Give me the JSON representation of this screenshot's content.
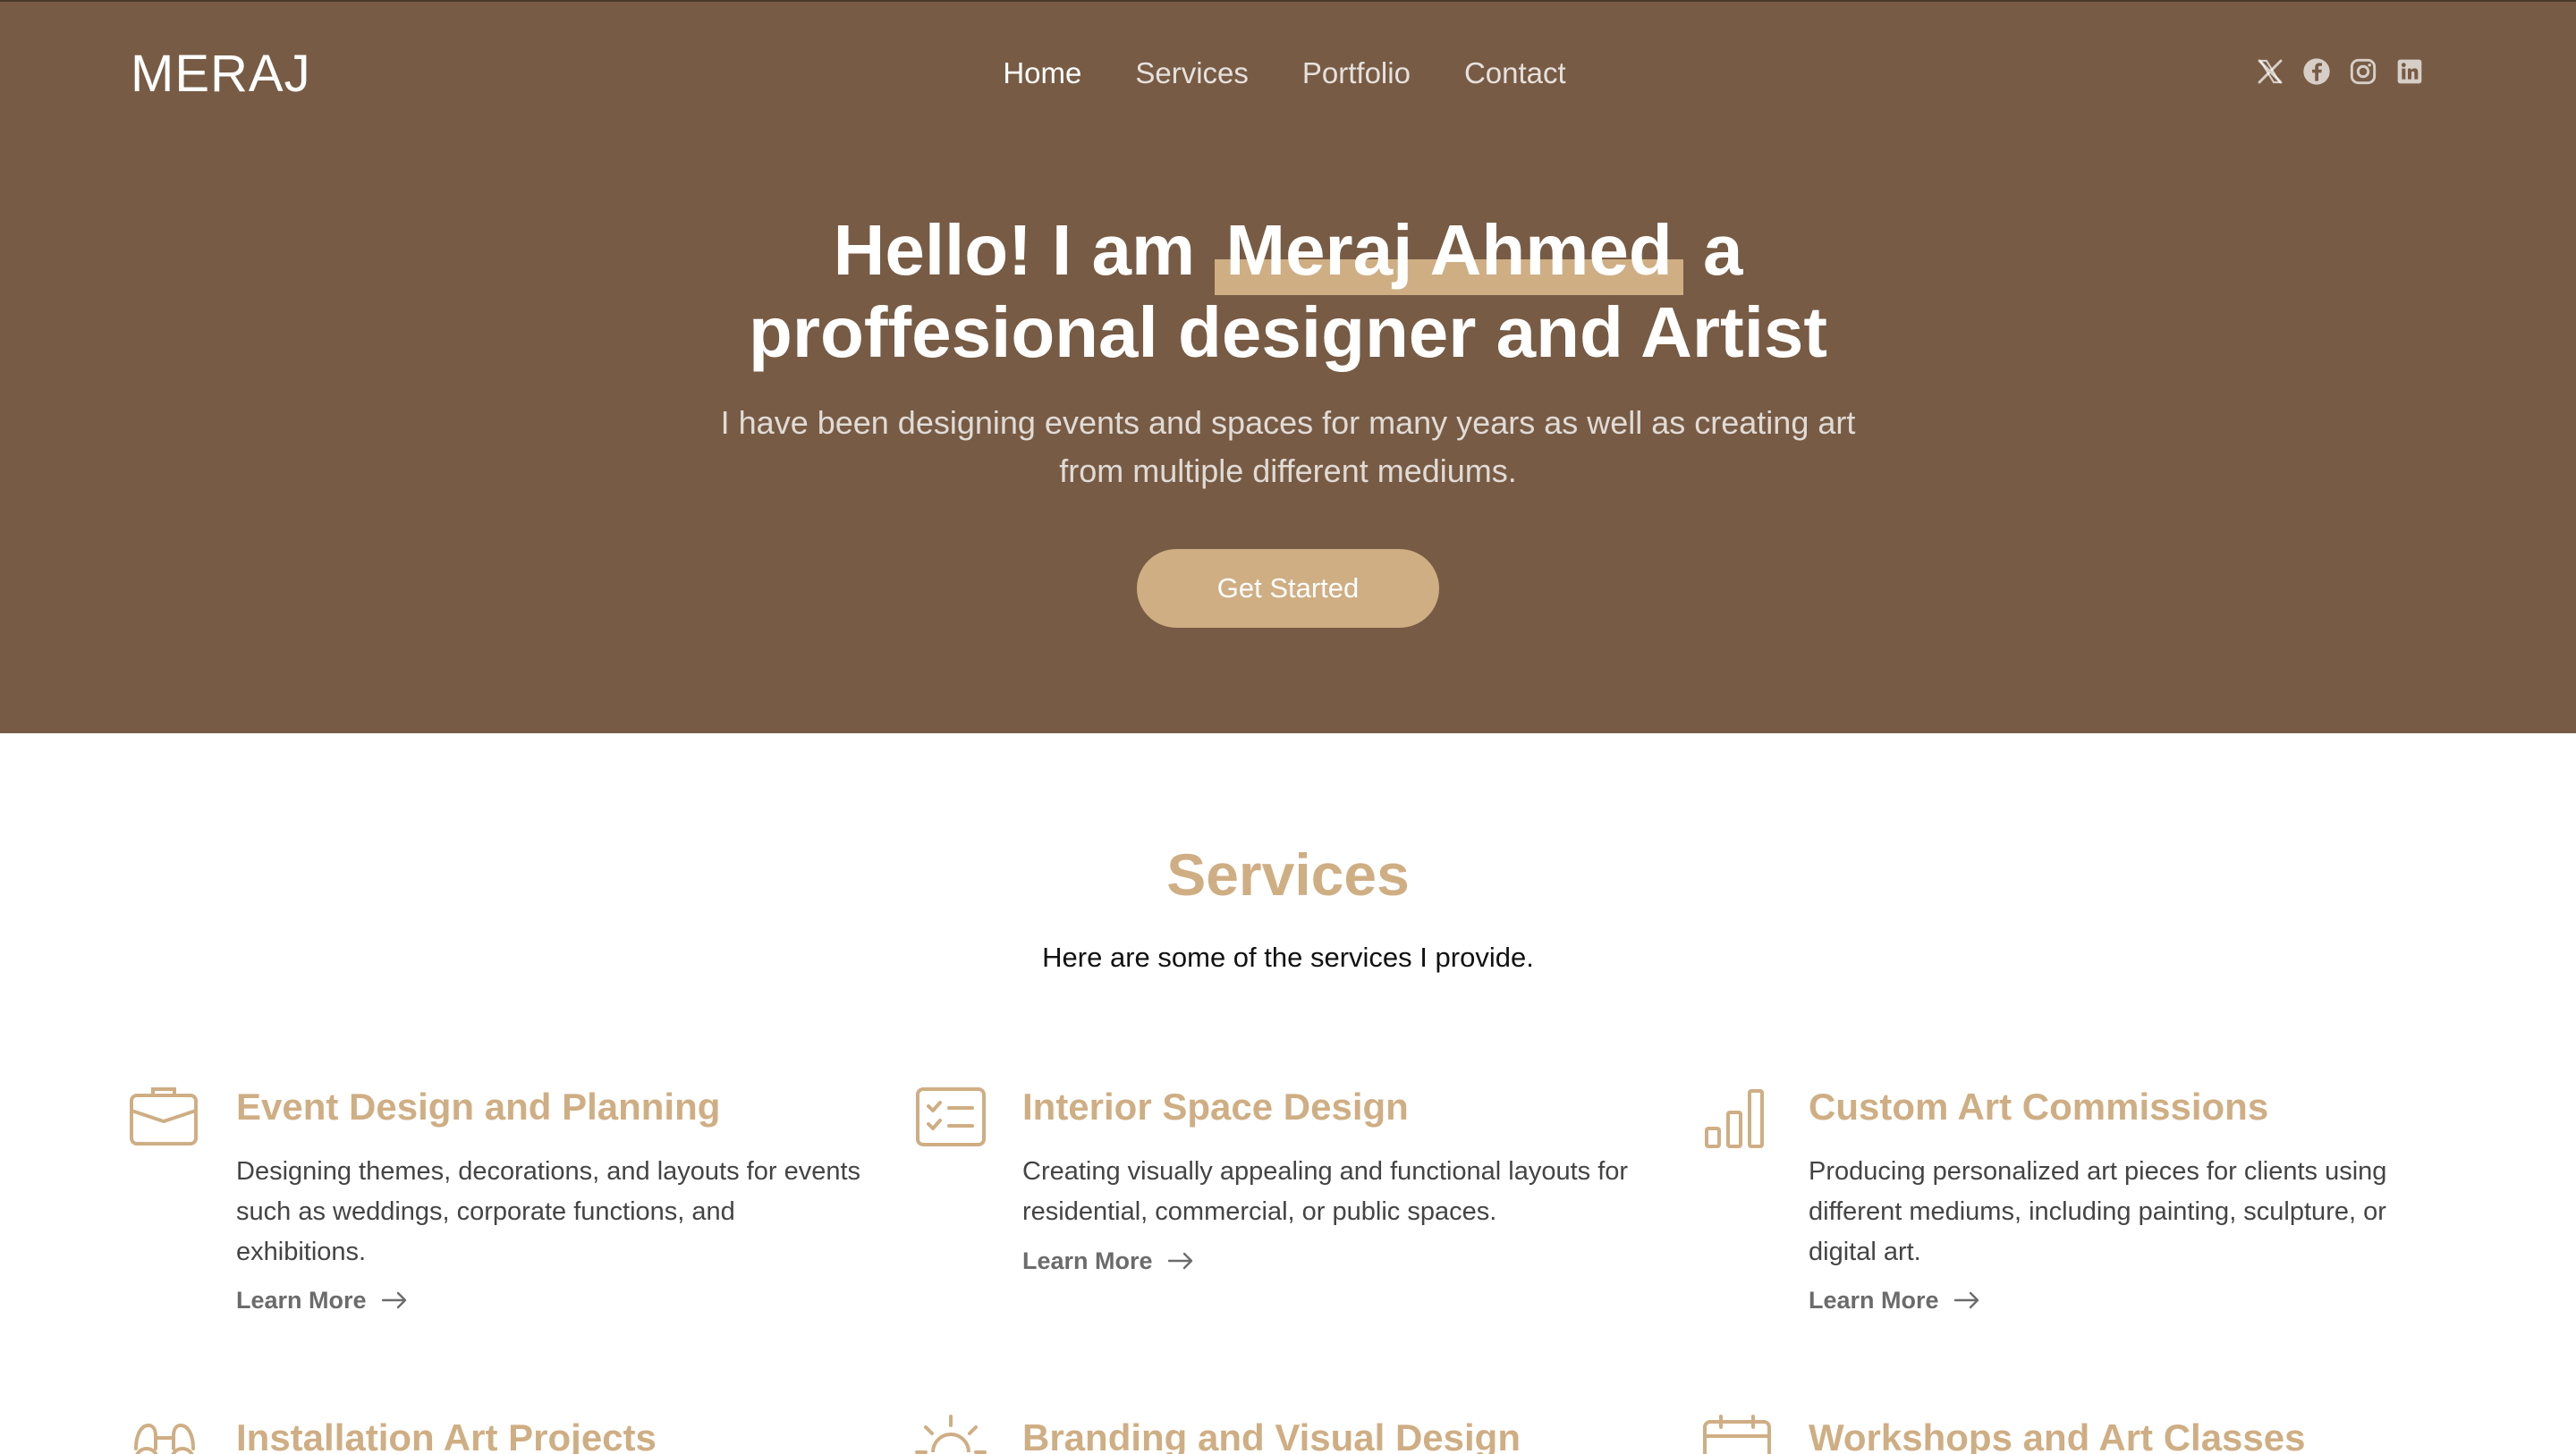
{
  "header": {
    "logo": "MERAJ",
    "nav": [
      {
        "label": "Home"
      },
      {
        "label": "Services"
      },
      {
        "label": "Portfolio"
      },
      {
        "label": "Contact"
      }
    ],
    "social_icons": [
      "x-icon",
      "facebook-icon",
      "instagram-icon",
      "linkedin-icon"
    ]
  },
  "hero": {
    "title_prefix": "Hello! I am",
    "title_name": "Meraj Ahmed",
    "title_suffix": "a",
    "title_line2": "proffesional designer and Artist",
    "subtitle": "I have been designing events and spaces for many years as well as creating art from multiple different mediums.",
    "cta_label": "Get Started"
  },
  "services": {
    "title": "Services",
    "subtitle": "Here are some of the services I provide.",
    "items": [
      {
        "icon": "briefcase-icon",
        "title": "Event Design and Planning",
        "description": "Designing themes, decorations, and layouts for events such as weddings, corporate functions, and exhibitions.",
        "link": "Learn More"
      },
      {
        "icon": "checklist-card-icon",
        "title": "Interior Space Design",
        "description": "Creating visually appealing and functional layouts for residential, commercial, or public spaces.",
        "link": "Learn More"
      },
      {
        "icon": "bar-chart-icon",
        "title": "Custom Art Commissions",
        "description": "Producing personalized art pieces for clients using different mediums, including painting, sculpture, or digital art.",
        "link": "Learn More"
      },
      {
        "icon": "binoculars-icon",
        "title": "Installation Art Projects"
      },
      {
        "icon": "sun-icon",
        "title": "Branding and Visual Design"
      },
      {
        "icon": "calendar-icon",
        "title": "Workshops and Art Classes"
      }
    ]
  },
  "colors": {
    "hero_bg": "#775b44",
    "accent": "#cfae84",
    "text_dark": "#111111",
    "text_body": "#444444"
  }
}
